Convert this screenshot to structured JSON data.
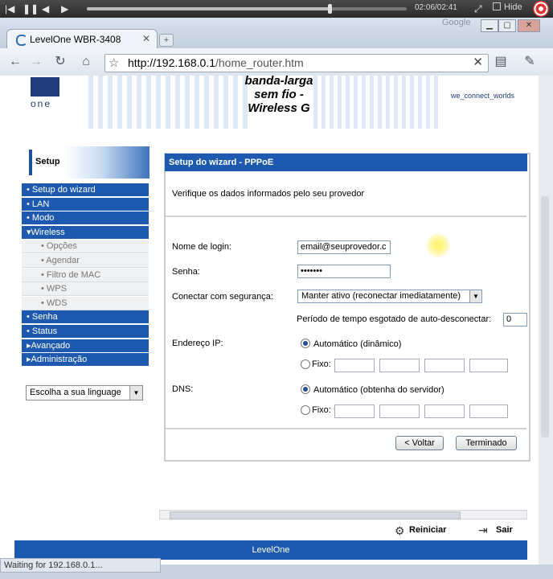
{
  "player": {
    "time": "02:06/02:41",
    "hide_label": "Hide"
  },
  "browser": {
    "tab_title": "LevelOne WBR-3408",
    "google_label": "Google",
    "url_host": "http://192.168.0.1",
    "url_path": "/home_router.htm",
    "status_text": "Waiting for 192.168.0.1..."
  },
  "header": {
    "logo_text": "one",
    "product_title": "banda-larga sem fio - Wireless G",
    "slogan": "we_connect_worlds"
  },
  "sidebar": {
    "section_title": "Setup",
    "items": [
      {
        "label": "• Setup do wizard"
      },
      {
        "label": "• LAN"
      },
      {
        "label": "• Modo"
      },
      {
        "label": "▾Wireless"
      },
      {
        "label": "• Opções"
      },
      {
        "label": "• Agendar"
      },
      {
        "label": "• Filtro de MAC"
      },
      {
        "label": "• WPS"
      },
      {
        "label": "• WDS"
      },
      {
        "label": "• Senha"
      },
      {
        "label": "• Status"
      },
      {
        "label": "▸Avançado"
      },
      {
        "label": "▸Administração"
      }
    ],
    "language_select": "Escolha a sua linguage"
  },
  "form": {
    "title": "Setup do wizard - PPPoE",
    "intro": "Verifique os dados informados pelo seu provedor",
    "login_label": "Nome de login:",
    "login_value": "email@seuprovedor.c",
    "password_label": "Senha:",
    "password_value": "•••••••",
    "connect_label": "Conectar com segurança:",
    "connect_value": "Manter ativo (reconectar imediatamente)",
    "timeout_label": "Período de tempo esgotado de auto-desconectar:",
    "timeout_value": "0",
    "ip_label": "Endereço IP:",
    "ip_auto": "Automático (dinâmico)",
    "ip_fixed": "Fixo:",
    "dns_label": "DNS:",
    "dns_auto": "Automático (obtenha do servidor)",
    "dns_fixed": "Fixo:",
    "back_button": "< Voltar",
    "finish_button": "Terminado"
  },
  "bottom": {
    "restart": "Reiniciar",
    "exit": "Sair",
    "footer": "LevelOne"
  }
}
